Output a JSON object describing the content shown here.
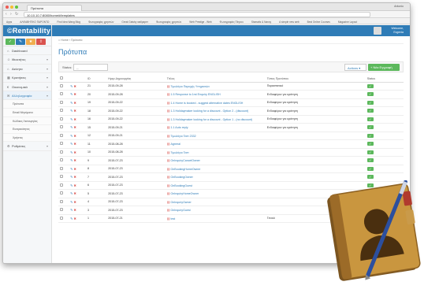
{
  "browser": {
    "tab_title": "Πρότυπα",
    "user": "Antonio",
    "url": "10.10.10.7:8080/home#/templates",
    "bookmarks": [
      "Apps",
      "ΑΛΦΑΒΗΤΙΚΟ ΠΑΡΟΝΤΩ",
      "Find Idea Wang Blog",
      "Φωτογραφίες χρηστών",
      "Great Gatsby wallpaper",
      "Φωτογραφίες χρηστών",
      "Web Prestige - Web",
      "Φωτογραφίες Πέτρου",
      "Stamatis & Nancy",
      "A simple new web",
      "Best Online Courses",
      "Magazine Layout"
    ]
  },
  "app": {
    "brand": "©Rentability",
    "user_name": "Welcome,",
    "user_sub": "Evgenia"
  },
  "sidebar": {
    "items": [
      {
        "label": "Dashboard",
        "icon": "home-icon"
      },
      {
        "label": "Ιθιοκτήτες",
        "icon": "user-icon",
        "chevron": true
      },
      {
        "label": "Ακίνητα",
        "icon": "house-icon",
        "chevron": true
      },
      {
        "label": "Κρατήσεις",
        "icon": "calendar-icon",
        "chevron": true
      },
      {
        "label": "Οικονομικά",
        "icon": "money-icon",
        "chevron": true
      },
      {
        "label": "Αλληλογραφία",
        "icon": "mail-icon",
        "chevron": true,
        "active": true
      }
    ],
    "subitems": [
      "Πρότυπα",
      "Email Μηνύματα",
      "Κώδικες Λειτουργίας",
      "Ευτεραιότητες",
      "Χρήστες"
    ],
    "footer": {
      "label": "Ρυθμίσεις",
      "icon": "gear-icon"
    }
  },
  "main": {
    "breadcrumb_home": "Home",
    "breadcrumb_current": "Πρότυπα",
    "title": "Πρότυπα",
    "status_label": "Status:",
    "status_value": "--",
    "actions_label": "Actions ▾",
    "new_label": "+ Νέα Εγγραφή",
    "columns": [
      "",
      "",
      "ID",
      "Ημερ.Δημιουργίας",
      "Τίτλος",
      "Τύπος Προτύπου",
      "Status"
    ],
    "rows": [
      {
        "id": "21",
        "date": "2015-09-28",
        "title": "Τιμολόγιο Παροχής Υπηρεσιών",
        "type": "Παραστατικό"
      },
      {
        "id": "20",
        "date": "2015-09-28",
        "title": "1.5 Response to 1rst Enquiry ENGLISH",
        "type": "Ενδιαφέρον για κράτηση"
      },
      {
        "id": "19",
        "date": "2015-09-22",
        "title": "1.4 Home is booked - suggest alternative dates ENGLISH",
        "type": "Ενδιαφέρον για κράτηση"
      },
      {
        "id": "18",
        "date": "2015-09-22",
        "title": "1.3 Holidaymaker looking for a discount - Option 2 - (discount)",
        "type": "Ενδιαφέρον για κράτηση"
      },
      {
        "id": "16",
        "date": "2015-09-22",
        "title": "1.3 Holidaymaker looking for a discount - Option 1 - (no discount)",
        "type": "Ενδιαφέρον για κράτηση"
      },
      {
        "id": "15",
        "date": "2015-09-21",
        "title": "1.1 Auto reply",
        "type": "Ενδιαφέρον για κράτηση"
      },
      {
        "id": "12",
        "date": "2015-09-21",
        "title": "Τιμολόγιο Τεστ 2332",
        "type": ""
      },
      {
        "id": "11",
        "date": "2015-08-28",
        "title": "Agreeal",
        "type": ""
      },
      {
        "id": "10",
        "date": "2015-08-28",
        "title": "Τιμολόγιο Τεστ",
        "type": ""
      },
      {
        "id": "9",
        "date": "2015-07-23",
        "title": "OnInquiryCancelOwner",
        "type": ""
      },
      {
        "id": "8",
        "date": "2015-07-23",
        "title": "OnBookingHomeOwner",
        "type": ""
      },
      {
        "id": "7",
        "date": "2015-07-23",
        "title": "OnBookingOwner",
        "type": ""
      },
      {
        "id": "6",
        "date": "2015-07-23",
        "title": "OnBookingGuest",
        "type": ""
      },
      {
        "id": "5",
        "date": "2015-07-23",
        "title": "OnInquiryHomeOwner",
        "type": ""
      },
      {
        "id": "4",
        "date": "2015-07-23",
        "title": "OnInquiryOwner",
        "type": ""
      },
      {
        "id": "3",
        "date": "2015-07-23",
        "title": "OnInquiryGuest",
        "type": ""
      },
      {
        "id": "1",
        "date": "2015-07-21",
        "title": "test",
        "type": "Γενικό"
      }
    ]
  },
  "colors": {
    "accent": "#2f7cb7",
    "success": "#5cb85c",
    "danger": "#d9534f",
    "book_cover": "#b7852f"
  }
}
